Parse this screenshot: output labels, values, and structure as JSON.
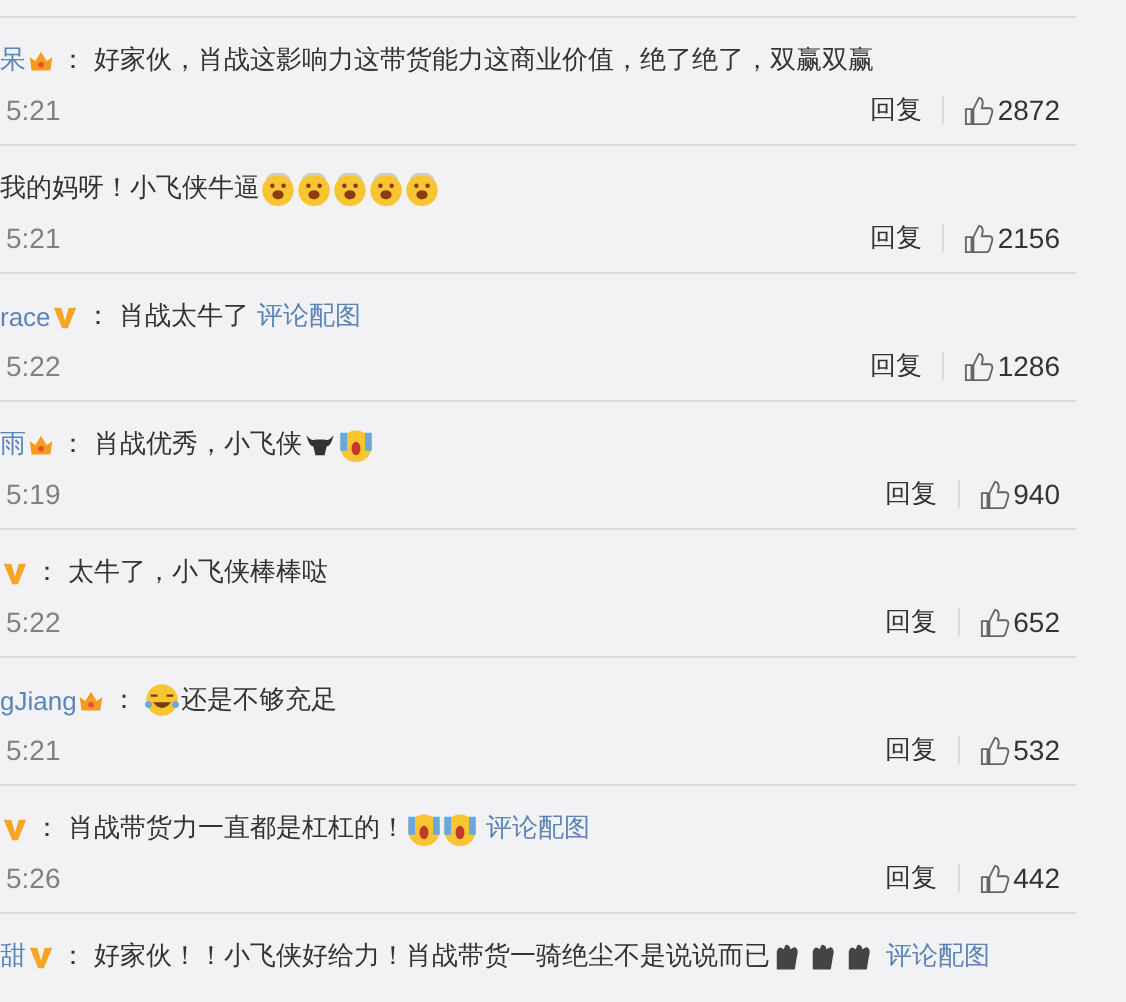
{
  "comments": [
    {
      "user": "呆",
      "badge": {
        "kind": "crown"
      },
      "colon": "：",
      "content": [
        {
          "kind": "text",
          "text": "好家伙，肖战这影响力这带货能力这商业价值，绝了绝了，双赢双赢"
        }
      ],
      "time": "5:21",
      "reply": "回复",
      "likes": "2872"
    },
    {
      "content": [
        {
          "kind": "text",
          "text": "我的妈呀！小飞侠牛逼"
        },
        {
          "kind": "wow"
        },
        {
          "kind": "wow"
        },
        {
          "kind": "wow"
        },
        {
          "kind": "wow"
        },
        {
          "kind": "wow"
        }
      ],
      "time": "5:21",
      "reply": "回复",
      "likes": "2156"
    },
    {
      "user": "race",
      "badge": {
        "kind": "vip"
      },
      "colon": "：",
      "content": [
        {
          "kind": "text",
          "text": "肖战太牛了"
        },
        {
          "kind": "link",
          "text": "评论配图"
        }
      ],
      "time": "5:22",
      "reply": "回复",
      "likes": "1286"
    },
    {
      "user": "雨",
      "badge": {
        "kind": "crown"
      },
      "colon": "：",
      "content": [
        {
          "kind": "text",
          "text": "肖战优秀，小飞侠"
        },
        {
          "kind": "bull"
        },
        {
          "kind": "scream"
        }
      ],
      "time": "5:19",
      "reply": "回复",
      "likes": "940"
    },
    {
      "badge": {
        "kind": "vip"
      },
      "colon": "：",
      "content": [
        {
          "kind": "text",
          "text": "太牛了，小飞侠棒棒哒"
        }
      ],
      "time": "5:22",
      "reply": "回复",
      "likes": "652"
    },
    {
      "user": "gJiang",
      "badge": {
        "kind": "crown"
      },
      "colon": "：",
      "content": [
        {
          "kind": "laugh"
        },
        {
          "kind": "text",
          "text": "还是不够充足"
        }
      ],
      "time": "5:21",
      "reply": "回复",
      "likes": "532"
    },
    {
      "badge": {
        "kind": "vip"
      },
      "colon": "：",
      "content": [
        {
          "kind": "text",
          "text": "肖战带货力一直都是杠杠的！"
        },
        {
          "kind": "scream"
        },
        {
          "kind": "scream"
        },
        {
          "kind": "link",
          "text": "评论配图"
        }
      ],
      "time": "5:26",
      "reply": "回复",
      "likes": "442"
    },
    {
      "user": "甜",
      "badge": {
        "kind": "vip"
      },
      "colon": "：",
      "content": [
        {
          "kind": "text",
          "text": "好家伙！！小飞侠好给力！肖战带货一骑绝尘不是说说而已"
        },
        {
          "kind": "clap"
        },
        {
          "kind": "clap"
        },
        {
          "kind": "clap"
        },
        {
          "kind": "link",
          "text": "评论配图"
        }
      ]
    }
  ]
}
